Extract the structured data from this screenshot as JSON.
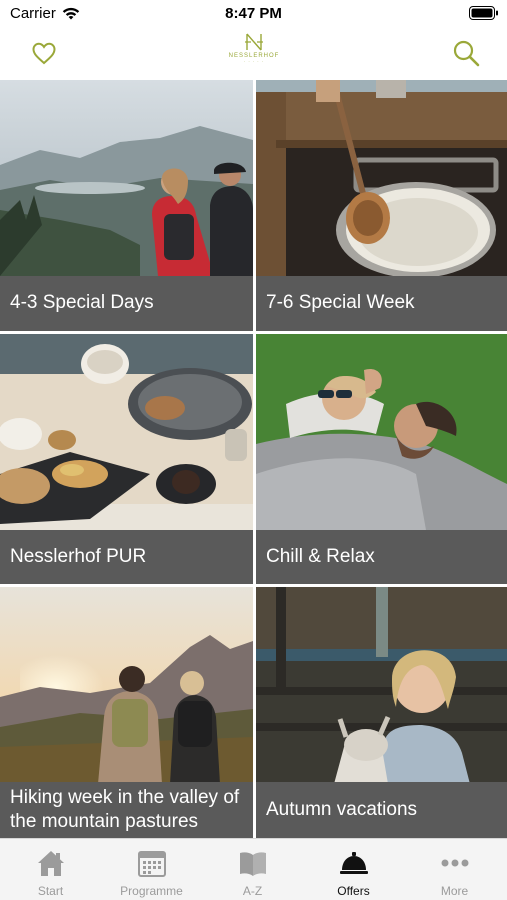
{
  "status_bar": {
    "carrier": "Carrier",
    "time": "8:47 PM"
  },
  "header": {
    "logo_text": "NESSLERHOF",
    "logo_subtext": "· · · · ·",
    "accent_color": "#9aa839"
  },
  "offers": [
    {
      "title": "4-3 Special Days"
    },
    {
      "title": "7-6 Special Week"
    },
    {
      "title": "Nesslerhof PUR"
    },
    {
      "title": "Chill & Relax"
    },
    {
      "title": "Hiking week in the valley of the mountain pastures"
    },
    {
      "title": "Autumn vacations"
    }
  ],
  "tabbar": {
    "active": "offers",
    "items": [
      {
        "id": "start",
        "label": "Start",
        "icon": "house-icon"
      },
      {
        "id": "programme",
        "label": "Programme",
        "icon": "calendar-icon"
      },
      {
        "id": "az",
        "label": "A-Z",
        "icon": "book-icon"
      },
      {
        "id": "offers",
        "label": "Offers",
        "icon": "service-bell-icon"
      },
      {
        "id": "more",
        "label": "More",
        "icon": "more-dots-icon"
      }
    ]
  }
}
